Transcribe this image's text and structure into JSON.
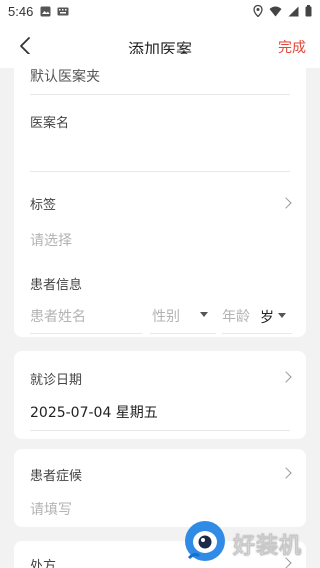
{
  "status": {
    "time": "5:46"
  },
  "header": {
    "title": "添加医案",
    "done_label": "完成"
  },
  "folder": {
    "value": "默认医案夹"
  },
  "case_name": {
    "label": "医案名"
  },
  "tags": {
    "label": "标签",
    "placeholder": "请选择"
  },
  "patient": {
    "label": "患者信息",
    "name_placeholder": "患者姓名",
    "gender_placeholder": "性别",
    "age_placeholder": "年龄",
    "age_unit": "岁"
  },
  "visit": {
    "label": "就诊日期",
    "value": "2025-07-04 星期五"
  },
  "symptoms": {
    "label": "患者症候",
    "placeholder": "请填写"
  },
  "prescription": {
    "label": "处方"
  },
  "watermark": {
    "text": "好装机"
  }
}
